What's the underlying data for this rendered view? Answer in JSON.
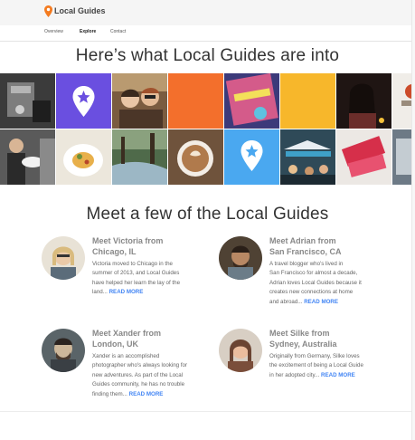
{
  "header": {
    "logo_text": "Local Guides",
    "nav": {
      "overview": "Overview",
      "explore": "Explore",
      "contact": "Contact"
    }
  },
  "hero": {
    "title": "Here’s what Local Guides are into"
  },
  "tiles": [
    {
      "name": "coffee-machine",
      "color": "#3b3b3b"
    },
    {
      "name": "pin-purple",
      "color": "#6a4fe0"
    },
    {
      "name": "friends-selfie",
      "color": "#8a6b4e"
    },
    {
      "name": "orange-solid",
      "color": "#f36f2c"
    },
    {
      "name": "festival-sign",
      "color": "#c24a6b"
    },
    {
      "name": "yellow-solid",
      "color": "#f7b72b"
    },
    {
      "name": "night-woman",
      "color": "#2a1d1a"
    },
    {
      "name": "partial-right",
      "color": "#d8d0c8"
    },
    {
      "name": "woman-tray",
      "color": "#555555"
    },
    {
      "name": "food-plate",
      "color": "#d9d2c0"
    },
    {
      "name": "forest-stream",
      "color": "#5b6e55"
    },
    {
      "name": "latte-cup",
      "color": "#8c6a48"
    },
    {
      "name": "pin-blue",
      "color": "#4aa8f0"
    },
    {
      "name": "street-market",
      "color": "#4f6c7a"
    },
    {
      "name": "tickets",
      "color": "#e8e4e0"
    },
    {
      "name": "partial-right-2",
      "color": "#6d7a86"
    }
  ],
  "guides_section": {
    "title": "Meet a few of the Local Guides"
  },
  "guides": [
    {
      "name_line1": "Meet Victoria from",
      "name_line2": "Chicago, IL",
      "bio": [
        "Victoria moved to Chicago in the",
        "summer of 2013, and Local Guides",
        "have helped her learn the lay of the",
        "land..."
      ],
      "read_more": "READ MORE",
      "avatar_colors": [
        "#c9b48a",
        "#e6d3b3"
      ]
    },
    {
      "name_line1": "Meet Adrian from",
      "name_line2": "San Francisco, CA",
      "bio": [
        "A travel blogger who's lived in",
        "San Francisco for almost a decade,",
        "Adrian loves Local Guides because it",
        "creates new connections at home",
        "and abroad..."
      ],
      "read_more": "READ MORE",
      "avatar_colors": [
        "#5a4634",
        "#a97e5c"
      ]
    },
    {
      "name_line1": "Meet Xander from",
      "name_line2": "London, UK",
      "bio": [
        "Xander is an accomplished",
        "photographer who's always looking for",
        "new adventures. As part of the Local",
        "Guides community, he has no trouble",
        "finding them..."
      ],
      "read_more": "READ MORE",
      "avatar_colors": [
        "#4a5358",
        "#c7b59a"
      ]
    },
    {
      "name_line1": "Meet Silke from",
      "name_line2": "Sydney, Australia",
      "bio": [
        "Originally from Germany, Silke loves",
        "the excitement of being a Local Guide",
        "in her adopted city..."
      ],
      "read_more": "READ MORE",
      "avatar_colors": [
        "#6b4b3a",
        "#e2b59a"
      ]
    }
  ]
}
